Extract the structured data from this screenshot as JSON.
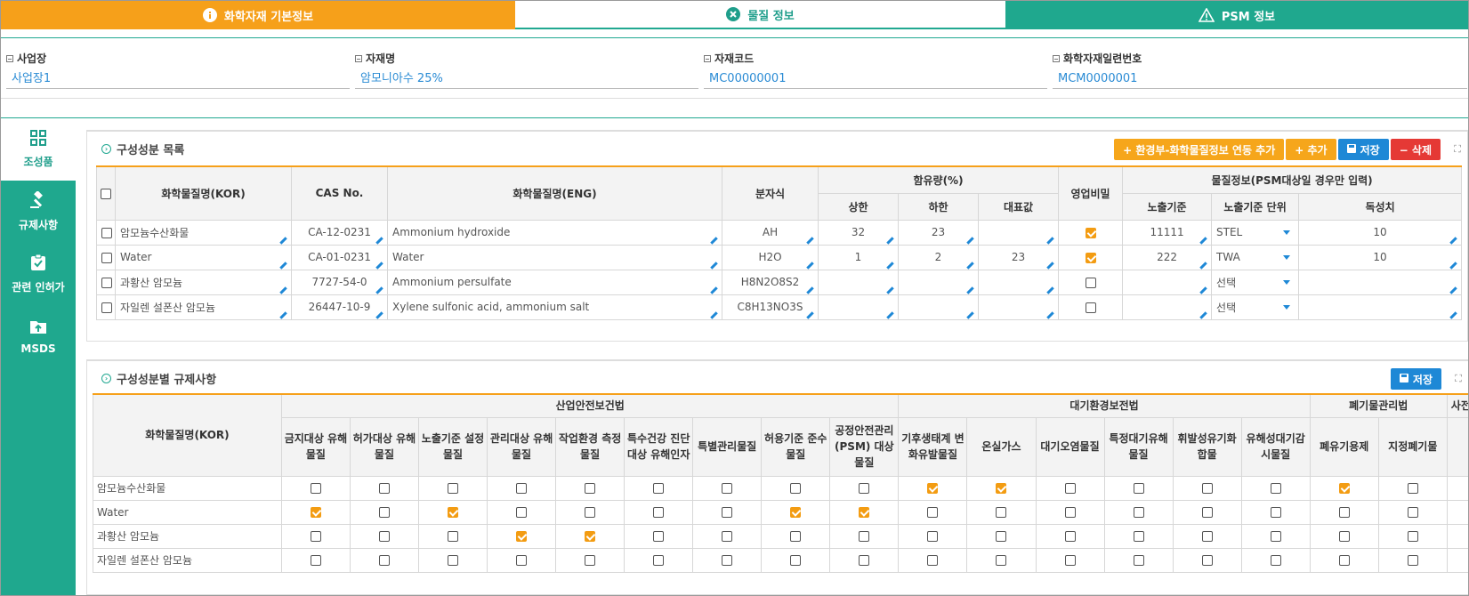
{
  "tabs": [
    {
      "label": "화학자재 기본정보",
      "icon": "info-icon"
    },
    {
      "label": "물질 정보",
      "icon": "close-circle-icon"
    },
    {
      "label": "PSM 정보",
      "icon": "warning-icon"
    }
  ],
  "info": {
    "site": {
      "label": "사업장",
      "value": "사업장1"
    },
    "material_name": {
      "label": "자재명",
      "value": "암모니아수 25%"
    },
    "material_code": {
      "label": "자재코드",
      "value": "MC00000001"
    },
    "serial": {
      "label": "화학자재일련번호",
      "value": "MCM0000001"
    }
  },
  "sidebar": [
    {
      "label": "조성품",
      "icon": "grid-icon"
    },
    {
      "label": "규제사항",
      "icon": "gavel-icon"
    },
    {
      "label": "관련 인허가",
      "icon": "clipboard-check-icon"
    },
    {
      "label": "MSDS",
      "icon": "folder-upload-icon"
    }
  ],
  "composition": {
    "title": "구성성분 목록",
    "buttons": {
      "link": "+ 환경부-화학물질정보 연동 추가",
      "add": "+ 추가",
      "save": "저장",
      "delete": "− 삭제"
    },
    "headers": {
      "kor": "화학물질명(KOR)",
      "cas": "CAS No.",
      "eng": "화학물질명(ENG)",
      "formula": "분자식",
      "content": "함유량(%)",
      "upper": "상한",
      "lower": "하한",
      "rep": "대표값",
      "secret": "영업비밀",
      "matinfo": "물질정보(PSM대상일 경우만 입력)",
      "exp": "노출기준",
      "exp_unit": "노출기준 단위",
      "tox": "독성치"
    },
    "rows": [
      {
        "kor": "암모늄수산화물",
        "cas": "CA-12-0231",
        "eng": "Ammonium hydroxide",
        "formula": "AH",
        "upper": "32",
        "lower": "23",
        "rep": "",
        "secret": true,
        "exp": "11111",
        "unit": "STEL",
        "tox": "10"
      },
      {
        "kor": "Water",
        "cas": "CA-01-0231",
        "eng": "Water",
        "formula": "H2O",
        "upper": "1",
        "lower": "2",
        "rep": "23",
        "secret": true,
        "exp": "222",
        "unit": "TWA",
        "tox": "10"
      },
      {
        "kor": "과황산 암모늄",
        "cas": "7727-54-0",
        "eng": "Ammonium persulfate",
        "formula": "H8N2O8S2",
        "upper": "",
        "lower": "",
        "rep": "",
        "secret": false,
        "exp": "",
        "unit": "선택",
        "tox": ""
      },
      {
        "kor": "자일렌 설폰산 암모늄",
        "cas": "26447-10-9",
        "eng": "Xylene sulfonic acid, ammonium salt",
        "formula": "C8H13NO3S",
        "upper": "",
        "lower": "",
        "rep": "",
        "secret": false,
        "exp": "",
        "unit": "선택",
        "tox": ""
      }
    ]
  },
  "regulation": {
    "title": "구성성분별 규제사항",
    "save": "저장",
    "name_header": "화학물질명(KOR)",
    "groups": [
      {
        "label": "산업안전보건법",
        "cols": [
          "금지대상 유해물질",
          "허가대상 유해물질",
          "노출기준 설정물질",
          "관리대상 유해물질",
          "작업환경 측정물질",
          "특수건강 진단대상 유해인자",
          "특별관리물질",
          "허용기준 준수물질",
          "공정안전관리(PSM) 대상물질"
        ]
      },
      {
        "label": "대기환경보전법",
        "cols": [
          "기후생태계 변화유발물질",
          "온실가스",
          "대기오염물질",
          "특정대기유해물질",
          "휘발성유기화합물",
          "유해성대기감시물질"
        ]
      },
      {
        "label": "폐기물관리법",
        "cols": [
          "폐유기용제",
          "지정폐기물"
        ]
      },
      {
        "label": "사전통",
        "cols": [
          ""
        ]
      }
    ],
    "rows": [
      {
        "name": "암모늄수산화물",
        "checks": [
          0,
          0,
          0,
          0,
          0,
          0,
          0,
          0,
          0,
          1,
          1,
          0,
          0,
          0,
          0,
          1,
          0,
          0
        ]
      },
      {
        "name": "Water",
        "checks": [
          1,
          0,
          1,
          0,
          0,
          0,
          0,
          1,
          1,
          0,
          0,
          0,
          0,
          0,
          0,
          0,
          0,
          0
        ]
      },
      {
        "name": "과황산 암모늄",
        "checks": [
          0,
          0,
          0,
          1,
          1,
          0,
          0,
          0,
          0,
          0,
          0,
          0,
          0,
          0,
          0,
          0,
          0,
          0
        ]
      },
      {
        "name": "자일렌 설폰산 암모늄",
        "checks": [
          0,
          0,
          0,
          0,
          0,
          0,
          0,
          0,
          0,
          0,
          0,
          0,
          0,
          0,
          0,
          0,
          0,
          0
        ]
      }
    ]
  }
}
